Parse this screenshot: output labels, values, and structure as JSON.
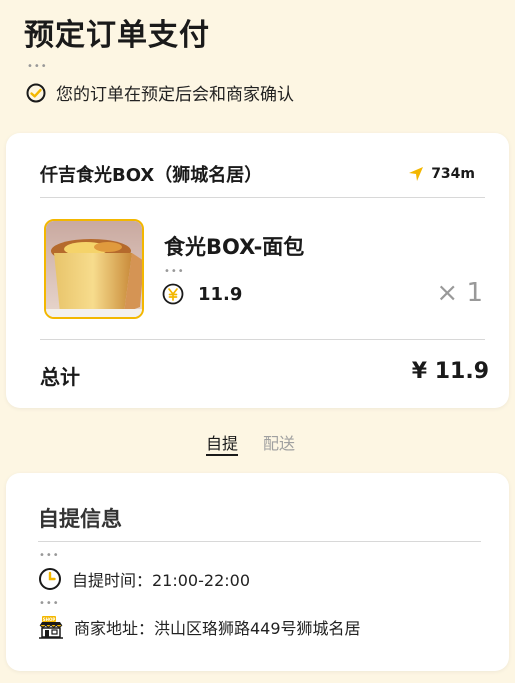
{
  "header": {
    "title": "预定订单支付",
    "notice": "您的订单在预定后会和商家确认"
  },
  "order": {
    "store_name": "仟吉食光BOX（狮城名居）",
    "distance": "734m",
    "product": {
      "name": "食光BOX-面包",
      "price": "11.9",
      "quantity": "× 1"
    },
    "total_label": "总计",
    "total_value": "¥ 11.9"
  },
  "tabs": [
    {
      "label": "自提",
      "active": true
    },
    {
      "label": "配送",
      "active": false
    }
  ],
  "pickup": {
    "title": "自提信息",
    "time_label": "自提时间：21:00-22:00",
    "address_label": "商家地址：洪山区珞狮路449号狮城名居"
  },
  "icons": {
    "notice": "check-circle-icon",
    "distance": "navigation-arrow-icon",
    "price": "yen-circle-icon",
    "time": "clock-icon",
    "address": "shop-icon"
  },
  "colors": {
    "background": "#fdf6e3",
    "accent": "#f3b700"
  }
}
